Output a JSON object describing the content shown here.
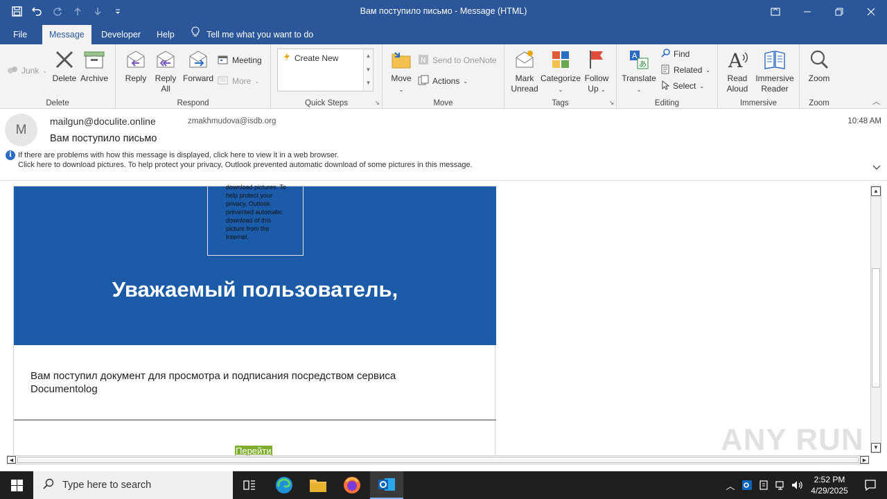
{
  "window": {
    "title": "Вам поступило письмо  -  Message (HTML)"
  },
  "tabs": [
    {
      "label": "File"
    },
    {
      "label": "Message"
    },
    {
      "label": "Developer"
    },
    {
      "label": "Help"
    }
  ],
  "tell_me": "Tell me what you want to do",
  "ribbon": {
    "delete_group": {
      "label": "Delete",
      "junk": "Junk",
      "delete": "Delete",
      "archive": "Archive"
    },
    "respond_group": {
      "label": "Respond",
      "reply": "Reply",
      "reply_all_1": "Reply",
      "reply_all_2": "All",
      "forward": "Forward",
      "meeting": "Meeting",
      "more": "More"
    },
    "quick_steps_group": {
      "label": "Quick Steps",
      "create_new": "Create New"
    },
    "move_group": {
      "label": "Move",
      "move": "Move",
      "send_onenote": "Send to OneNote",
      "actions": "Actions"
    },
    "tags_group": {
      "label": "Tags",
      "mark_unread_1": "Mark",
      "mark_unread_2": "Unread",
      "categorize": "Categorize",
      "follow_up_1": "Follow",
      "follow_up_2": "Up"
    },
    "editing_group": {
      "label": "Editing",
      "translate": "Translate",
      "find": "Find",
      "related": "Related",
      "select": "Select"
    },
    "immersive_group": {
      "label": "Immersive",
      "read_aloud_1": "Read",
      "read_aloud_2": "Aloud",
      "immersive_reader_1": "Immersive",
      "immersive_reader_2": "Reader"
    },
    "zoom_group": {
      "label": "Zoom",
      "zoom": "Zoom"
    }
  },
  "message": {
    "avatar_letter": "M",
    "from": "mailgun@doculite.online",
    "to": "zmakhmudova@isdb.org",
    "time": "10:48 AM",
    "subject": "Вам поступило письмо",
    "info_line_1": "If there are problems with how this message is displayed, click here to view it in a web browser.",
    "info_line_2": "Click here to download pictures. To help protect your privacy, Outlook prevented automatic download of some pictures in this message."
  },
  "email_body": {
    "image_placeholder": "download pictures. To help protect your privacy, Outlook prevented automatic download of this picture from the Internet.",
    "greeting": "Уважаемый пользователь,",
    "document_text": "Вам поступил документ для просмотра и подписания посредством сервиса Documentolog",
    "go_button": "Перейти",
    "banner_color": "#1c5ba8",
    "button_color": "#7fae2c"
  },
  "watermark": "ANY RUN",
  "taskbar": {
    "search_placeholder": "Type here to search",
    "time": "2:52 PM",
    "date": "4/29/2025"
  },
  "colors": {
    "accent": "#2b579a"
  }
}
